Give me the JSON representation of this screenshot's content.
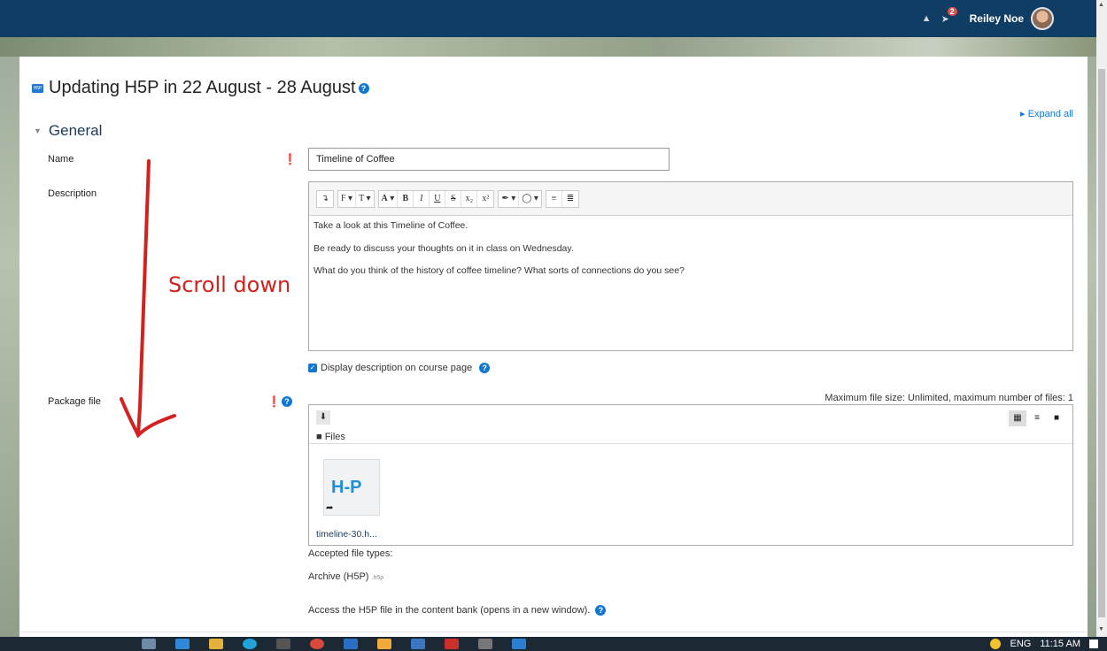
{
  "navbar": {
    "notification_count": "2",
    "username": "Reiley Noe"
  },
  "page": {
    "title": "Updating H5P in 22 August - 28 August",
    "expand_all": "Expand all"
  },
  "general": {
    "heading": "General",
    "name_label": "Name",
    "name_value": "Timeline of Coffee",
    "description_label": "Description",
    "description_paragraphs": [
      "Take a look at this Timeline of Coffee.",
      "Be ready to discuss your thoughts on it in class on Wednesday.",
      "What do you think of the history of coffee timeline? What sorts of connections do you see?"
    ],
    "display_description_label": "Display description on course page",
    "package_label": "Package file",
    "max_file_size": "Maximum file size: Unlimited, maximum number of files: 1",
    "files_crumb": "Files",
    "file_name": "timeline-30.h...",
    "accepted_label": "Accepted file types:",
    "accepted_type": "Archive (H5P)",
    "accepted_ext": ".h5p",
    "access_text": "Access the H5P file in the content bank (opens in a new window)."
  },
  "annotation": {
    "text": "Scroll down"
  },
  "taskbar": {
    "lang": "ENG",
    "time": "11:15 AM"
  },
  "colors": {
    "navbar": "#0f3d63",
    "link": "#1177d1",
    "required": "#c9302c",
    "annotation": "#d2211e"
  }
}
